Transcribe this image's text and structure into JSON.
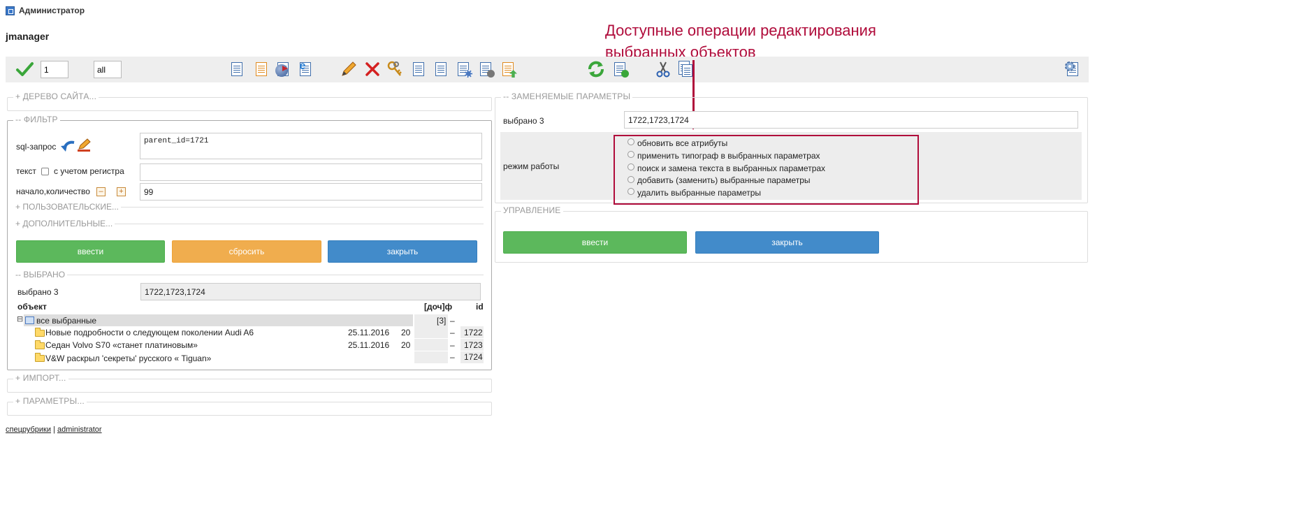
{
  "window": {
    "title": "Администратор"
  },
  "app": {
    "name": "jmanager"
  },
  "annotation": {
    "line1": "Доступные операции редактирования",
    "line2": "выбранных объектов"
  },
  "toolbar": {
    "page_value": "1",
    "count_value": "all",
    "icons": [
      "confirm-check-icon",
      "document-list-icon",
      "document-orange-icon",
      "globe-document-icon",
      "ie-document-icon",
      "edit-pencil-icon",
      "delete-x-icon",
      "keys-icon",
      "document-tree-icon",
      "document-table-icon",
      "document-gear-icon",
      "document-tools-icon",
      "document-export-icon",
      "refresh-arrows-icon",
      "document-import-icon",
      "scissors-icon",
      "copy-documents-icon",
      "settings-panel-icon"
    ]
  },
  "left": {
    "site_tree": "+ ДЕРЕВО САЙТА...",
    "filter": {
      "legend": "-- ФИЛЬТР",
      "sql_label": "sql-запрос",
      "sql_value": "parent_id=1721",
      "text_label": "текст",
      "case_label": "с учетом регистра",
      "text_value": "",
      "start_label": "начало,количество",
      "minus": "–",
      "plus": "+",
      "count_value": "99",
      "user_section": "+ ПОЛЬЗОВАТЕЛЬСКИЕ...",
      "extra_section": "+ ДОПОЛНИТЕЛЬНЫЕ...",
      "btn_submit": "ввести",
      "btn_reset": "сбросить",
      "btn_close": "закрыть"
    },
    "selected": {
      "legend": "-- ВЫБРАНО",
      "label": "выбрано 3",
      "value": "1722,1723,1724",
      "headers": {
        "object": "объект",
        "docf": "[доч]ф",
        "id": "id"
      },
      "root": {
        "toggle": "⊟",
        "name": "все выбранные",
        "count": "[3]",
        "dash": "–"
      },
      "rows": [
        {
          "name": "Новые подробности о следующем поколении Audi A6",
          "date": "25.11.2016",
          "num": "20",
          "dash": "–",
          "id": "1722"
        },
        {
          "name": "Седан Volvo S70 «станет платиновым»",
          "date": "25.11.2016",
          "num": "20",
          "dash": "–",
          "id": "1723"
        },
        {
          "name": "V&W раскрыл 'секреты' русского « Tiguan»",
          "date": "",
          "num": "",
          "dash": "–",
          "id": "1724"
        }
      ]
    },
    "import": "+ ИМПОРТ...",
    "params": "+ ПАРАМЕТРЫ..."
  },
  "right": {
    "replace": {
      "legend": "-- ЗАМЕНЯЕМЫЕ ПАРАМЕТРЫ",
      "selected_label": "выбрано 3",
      "selected_value": "1722,1723,1724",
      "mode_label": "режим работы",
      "options": [
        "обновить все атрибуты",
        "применить типограф в выбранных параметрах",
        "поиск и замена текста в выбранных параметрах",
        "добавить (заменить) выбранные параметры",
        "удалить выбранные параметры"
      ]
    },
    "control": {
      "legend": "УПРАВЛЕНИЕ",
      "btn_submit": "ввести",
      "btn_close": "закрыть"
    }
  },
  "footer": {
    "link1": "спецрубрики",
    "sep": "|",
    "link2": "administrator"
  },
  "colors": {
    "annotation": "#b00c3b",
    "green": "#5cb85c",
    "orange": "#f0ad4e",
    "blue": "#428bca"
  }
}
